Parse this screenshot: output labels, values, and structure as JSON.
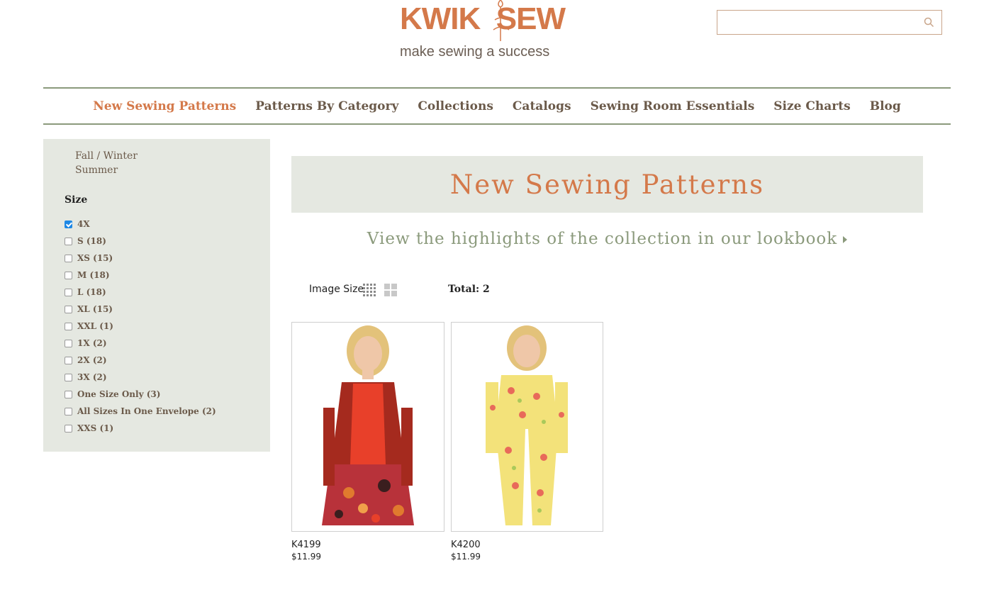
{
  "header": {
    "logo_brand": "KWIK  SEW",
    "logo_tagline": "make sewing a success",
    "search_placeholder": ""
  },
  "nav": {
    "items": [
      {
        "label": "New Sewing Patterns",
        "active": true
      },
      {
        "label": "Patterns By Category",
        "active": false
      },
      {
        "label": "Collections",
        "active": false
      },
      {
        "label": "Catalogs",
        "active": false
      },
      {
        "label": "Sewing Room Essentials",
        "active": false
      },
      {
        "label": "Size Charts",
        "active": false
      },
      {
        "label": "Blog",
        "active": false
      }
    ]
  },
  "sidebar": {
    "seasons": [
      "Fall / Winter",
      "Summer"
    ],
    "size_heading": "Size",
    "sizes": [
      {
        "label": "4X",
        "checked": true
      },
      {
        "label": "S (18)",
        "checked": false
      },
      {
        "label": "XS (15)",
        "checked": false
      },
      {
        "label": "M (18)",
        "checked": false
      },
      {
        "label": "L (18)",
        "checked": false
      },
      {
        "label": "XL (15)",
        "checked": false
      },
      {
        "label": "XXL (1)",
        "checked": false
      },
      {
        "label": "1X (2)",
        "checked": false
      },
      {
        "label": "2X (2)",
        "checked": false
      },
      {
        "label": "3X (2)",
        "checked": false
      },
      {
        "label": "One Size Only (3)",
        "checked": false
      },
      {
        "label": "All Sizes In One Envelope (2)",
        "checked": false
      },
      {
        "label": "XXS (1)",
        "checked": false
      }
    ]
  },
  "main": {
    "banner_title": "New Sewing Patterns",
    "lookbook_link": "View the highlights of the collection in our lookbook",
    "image_size_label": "Image Size",
    "total_label": "Total: 2",
    "products": [
      {
        "code": "K4199",
        "price": "$11.99"
      },
      {
        "code": "K4200",
        "price": "$11.99"
      }
    ]
  },
  "colors": {
    "accent": "#d4794a",
    "sage": "#8b9a7c",
    "panel": "#e5e8e1",
    "checkbox": "#1e88e5"
  }
}
